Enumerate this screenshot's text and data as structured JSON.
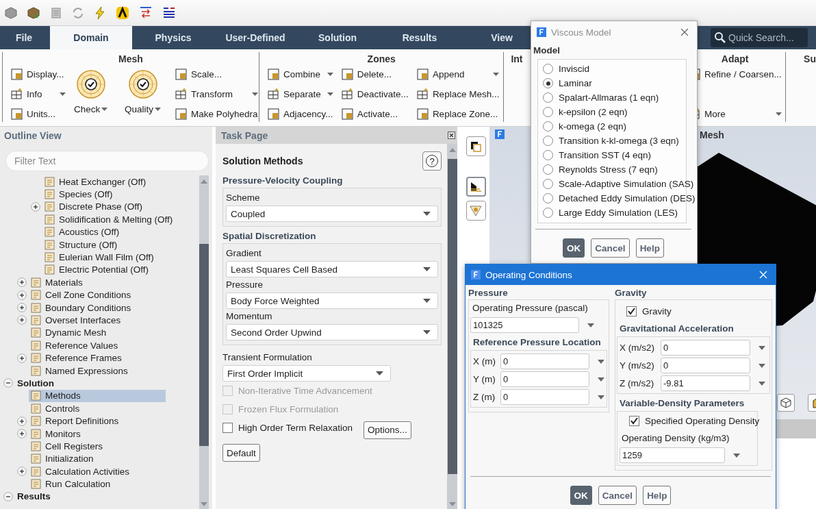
{
  "ribbon": {
    "tabs": [
      {
        "label": "File",
        "selected": false
      },
      {
        "label": "Domain",
        "selected": true
      },
      {
        "label": "Physics",
        "selected": false
      },
      {
        "label": "User-Defined",
        "selected": false
      },
      {
        "label": "Solution",
        "selected": false
      },
      {
        "label": "Results",
        "selected": false
      },
      {
        "label": "View",
        "selected": false
      }
    ],
    "quick_search": {
      "placeholder": "Quick Search..."
    },
    "groups": [
      {
        "title": "Mesh",
        "columns": [
          {
            "kind": "small",
            "items": [
              {
                "label": "Display...",
                "dropdown": false
              },
              {
                "label": "Info",
                "dropdown": true
              },
              {
                "label": "Units...",
                "dropdown": false
              }
            ]
          },
          {
            "kind": "large",
            "items": [
              {
                "label": "Check",
                "dropdown": true
              }
            ]
          },
          {
            "kind": "large",
            "items": [
              {
                "label": "Quality",
                "dropdown": true
              }
            ]
          },
          {
            "kind": "small",
            "items": [
              {
                "label": "Scale...",
                "dropdown": false
              },
              {
                "label": "Transform",
                "dropdown": true
              },
              {
                "label": "Make Polyhedra",
                "dropdown": false
              }
            ]
          }
        ]
      },
      {
        "title": "Zones",
        "columns": [
          {
            "kind": "small",
            "items": [
              {
                "label": "Combine",
                "dropdown": true
              },
              {
                "label": "Separate",
                "dropdown": true
              },
              {
                "label": "Adjacency...",
                "dropdown": false
              }
            ]
          },
          {
            "kind": "small",
            "items": [
              {
                "label": "Delete...",
                "dropdown": false
              },
              {
                "label": "Deactivate...",
                "dropdown": false
              },
              {
                "label": "Activate...",
                "dropdown": false
              }
            ]
          },
          {
            "kind": "small",
            "items": [
              {
                "label": "Append",
                "dropdown": true
              },
              {
                "label": "Replace Mesh...",
                "dropdown": false
              },
              {
                "label": "Replace Zone...",
                "dropdown": false
              }
            ]
          }
        ]
      },
      {
        "title": "Int"
      },
      {
        "title": "Adapt",
        "columns": [
          {
            "kind": "small",
            "items": [
              {
                "label": "Refine / Coarsen...",
                "dropdown": false
              },
              {
                "label": "More",
                "dropdown": true
              }
            ]
          }
        ]
      },
      {
        "title": "Su"
      }
    ]
  },
  "outline": {
    "title": "Outline View",
    "filter": {
      "placeholder": "Filter Text"
    },
    "tree": [
      {
        "children": [
          {
            "children": [
              {
                "label": "Heat Exchanger (Off)",
                "selected": false
              },
              {
                "label": "Species (Off)",
                "selected": false
              },
              {
                "label": "Discrete Phase (Off)",
                "expanded": false,
                "selected": false
              },
              {
                "label": "Solidification & Melting (Off)",
                "selected": false
              },
              {
                "label": "Acoustics (Off)",
                "selected": false
              },
              {
                "label": "Structure (Off)",
                "selected": false
              },
              {
                "label": "Eulerian Wall Film (Off)",
                "selected": false
              },
              {
                "label": "Electric Potential (Off)",
                "selected": false
              }
            ]
          },
          {
            "label": "Materials",
            "expanded": false,
            "selected": false
          },
          {
            "label": "Cell Zone Conditions",
            "expanded": false,
            "selected": false
          },
          {
            "label": "Boundary Conditions",
            "expanded": false,
            "selected": false
          },
          {
            "label": "Overset Interfaces",
            "expanded": false,
            "selected": false
          },
          {
            "label": "Dynamic Mesh",
            "selected": false
          },
          {
            "label": "Reference Values",
            "selected": false
          },
          {
            "label": "Reference Frames",
            "expanded": false,
            "selected": false
          },
          {
            "label": "Named Expressions",
            "selected": false
          }
        ]
      },
      {
        "label": "Solution",
        "expanded": true,
        "selected": false,
        "children": [
          {
            "label": "Methods",
            "selected": true
          },
          {
            "label": "Controls",
            "selected": false
          },
          {
            "label": "Report Definitions",
            "expanded": false,
            "selected": false
          },
          {
            "label": "Monitors",
            "expanded": false,
            "selected": false
          },
          {
            "label": "Cell Registers",
            "selected": false
          },
          {
            "label": "Initialization",
            "selected": false
          },
          {
            "label": "Calculation Activities",
            "expanded": false,
            "selected": false
          },
          {
            "label": "Run Calculation",
            "selected": false
          }
        ]
      },
      {
        "label": "Results",
        "expanded": true,
        "selected": false
      }
    ]
  },
  "task_page": {
    "title": "Task Page",
    "heading": "Solution Methods",
    "help": "?",
    "sections": [
      {
        "title": "Pressure-Velocity Coupling",
        "fields": [
          {
            "label": "Scheme",
            "value": "Coupled"
          }
        ]
      },
      {
        "title": "Spatial Discretization",
        "fields": [
          {
            "label": "Gradient",
            "value": "Least Squares Cell Based"
          },
          {
            "label": "Pressure",
            "value": "Body Force Weighted"
          },
          {
            "label": "Momentum",
            "value": "Second Order Upwind"
          }
        ]
      }
    ],
    "transient": {
      "label": "Transient Formulation",
      "value": "First Order Implicit"
    },
    "options": [
      {
        "label": "Non-Iterative Time Advancement",
        "checked": false,
        "disabled": true
      },
      {
        "label": "Frozen Flux Formulation",
        "checked": false,
        "disabled": true
      },
      {
        "label": "High Order Term Relaxation",
        "checked": false,
        "disabled": false,
        "button": "Options..."
      }
    ],
    "default_button": "Default"
  },
  "graphics": {
    "title": "Mesh"
  },
  "viscous_model": {
    "title": "Viscous Model",
    "group_title": "Model",
    "options": [
      {
        "label": "Inviscid",
        "selected": false
      },
      {
        "label": "Laminar",
        "selected": true
      },
      {
        "label": "Spalart-Allmaras (1 eqn)",
        "selected": false
      },
      {
        "label": "k-epsilon (2 eqn)",
        "selected": false
      },
      {
        "label": "k-omega (2 eqn)",
        "selected": false
      },
      {
        "label": "Transition k-kl-omega (3 eqn)",
        "selected": false
      },
      {
        "label": "Transition SST (4 eqn)",
        "selected": false
      },
      {
        "label": "Reynolds Stress (7 eqn)",
        "selected": false
      },
      {
        "label": "Scale-Adaptive Simulation (SAS)",
        "selected": false
      },
      {
        "label": "Detached Eddy Simulation (DES)",
        "selected": false
      },
      {
        "label": "Large Eddy Simulation (LES)",
        "selected": false
      }
    ],
    "buttons": [
      {
        "label": "OK",
        "default": true
      },
      {
        "label": "Cancel",
        "default": false
      },
      {
        "label": "Help",
        "default": false
      }
    ]
  },
  "operating_conditions": {
    "title": "Operating Conditions",
    "pressure": {
      "title": "Pressure",
      "operating_pressure": {
        "label": "Operating Pressure (pascal)",
        "value": "101325"
      },
      "reference_location": {
        "title": "Reference Pressure Location",
        "fields": [
          {
            "label": "X (m)",
            "value": "0"
          },
          {
            "label": "Y (m)",
            "value": "0"
          },
          {
            "label": "Z (m)",
            "value": "0"
          }
        ]
      }
    },
    "gravity": {
      "title": "Gravity",
      "checkbox": {
        "label": "Gravity",
        "checked": true
      },
      "acceleration": {
        "title": "Gravitational Acceleration",
        "fields": [
          {
            "label": "X (m/s2)",
            "value": "0"
          },
          {
            "label": "Y (m/s2)",
            "value": "0"
          },
          {
            "label": "Z (m/s2)",
            "value": "-9.81"
          }
        ]
      },
      "variable_density": {
        "title": "Variable-Density Parameters",
        "checkbox": {
          "label": "Specified Operating Density",
          "checked": true
        },
        "density": {
          "label": "Operating Density (kg/m3)",
          "value": "1259"
        }
      }
    },
    "buttons": [
      {
        "label": "OK",
        "default": true
      },
      {
        "label": "Cancel",
        "default": false
      },
      {
        "label": "Help",
        "default": false
      }
    ]
  }
}
